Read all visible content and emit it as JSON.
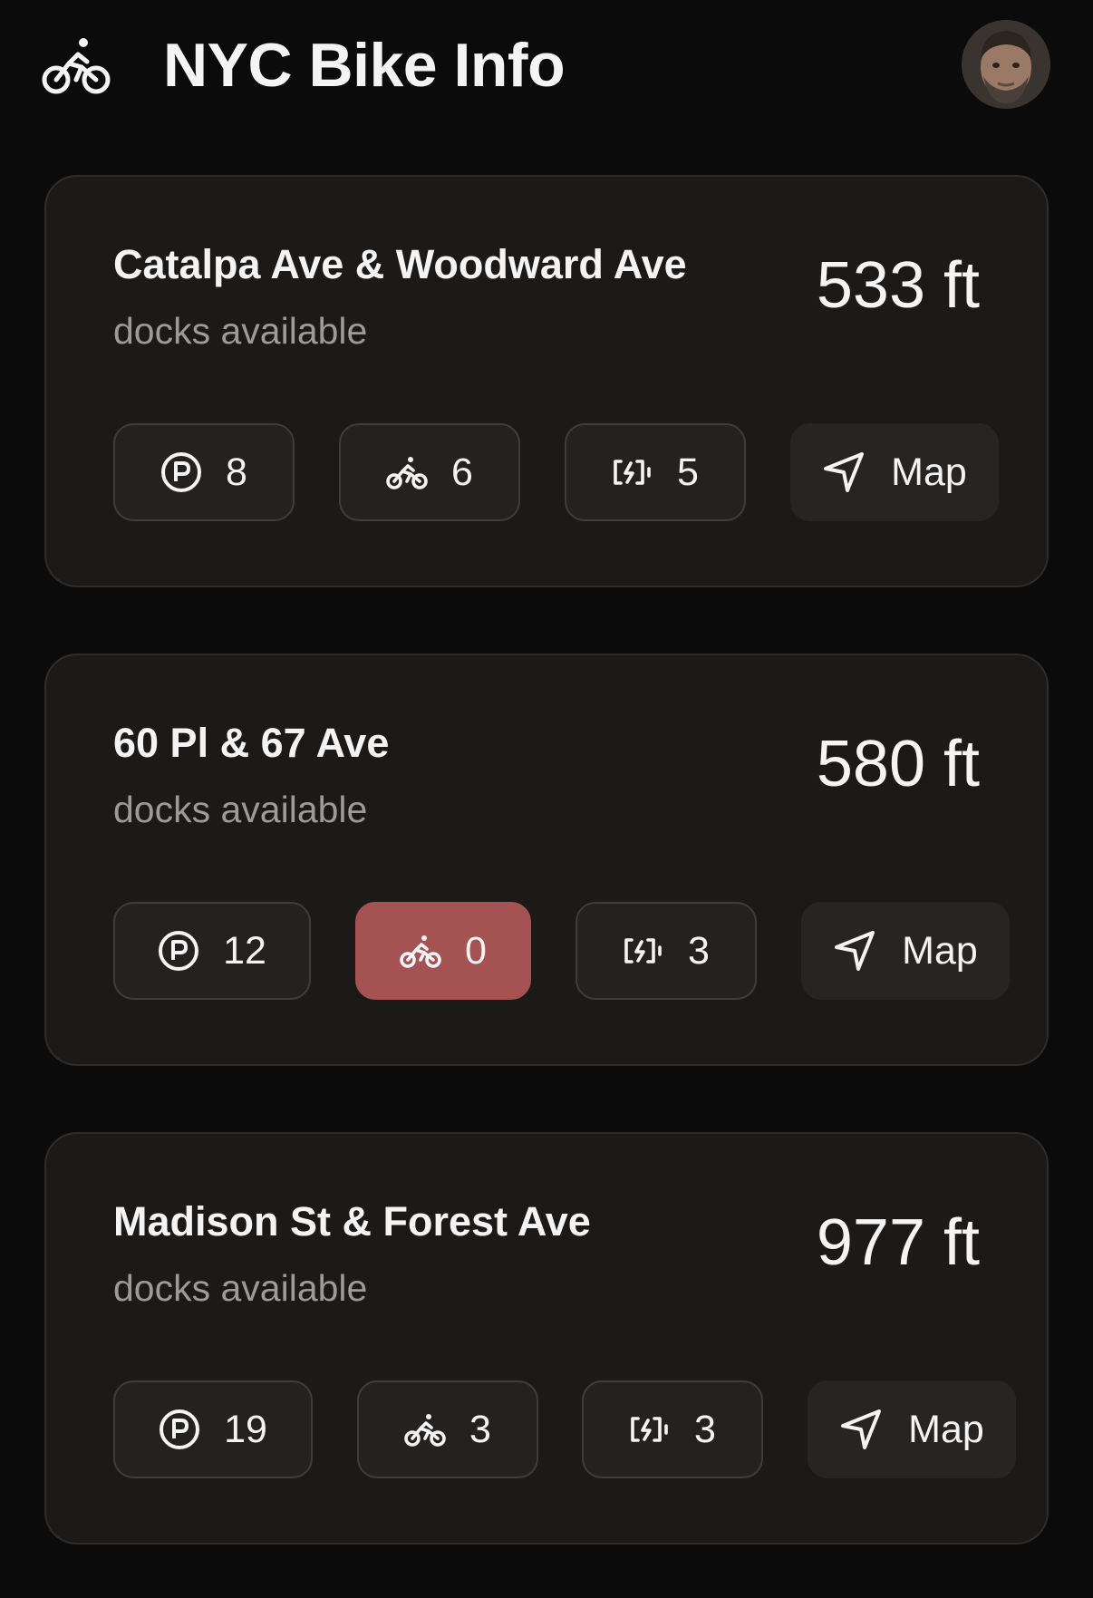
{
  "header": {
    "title": "NYC Bike Info",
    "app_icon": "bicycle-rider-icon",
    "avatar": "user-avatar"
  },
  "stations": [
    {
      "name": "Catalpa Ave & Woodward Ave",
      "subtitle": "docks available",
      "distance": "533 ft",
      "docks": "8",
      "bikes": "6",
      "ebikes": "5",
      "map_label": "Map",
      "bikes_alert": false
    },
    {
      "name": "60 Pl & 67 Ave",
      "subtitle": "docks available",
      "distance": "580 ft",
      "docks": "12",
      "bikes": "0",
      "ebikes": "3",
      "map_label": "Map",
      "bikes_alert": true
    },
    {
      "name": "Madison St & Forest Ave",
      "subtitle": "docks available",
      "distance": "977 ft",
      "docks": "19",
      "bikes": "3",
      "ebikes": "3",
      "map_label": "Map",
      "bikes_alert": false
    }
  ],
  "colors": {
    "background": "#0b0b0b",
    "card": "#1b1a19",
    "alert": "#a45252",
    "muted_text": "#9c9b98"
  }
}
